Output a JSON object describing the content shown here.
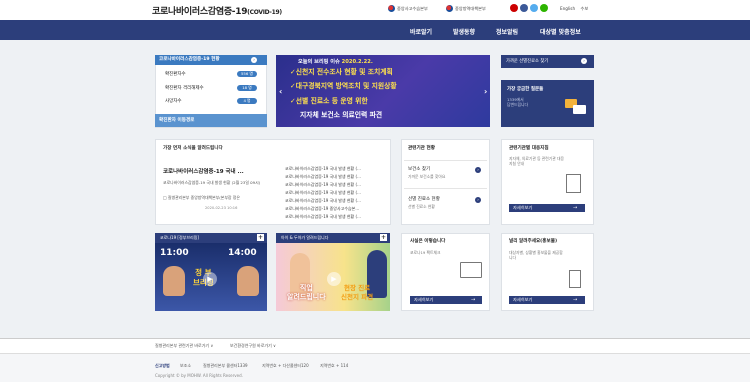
{
  "header": {
    "title_main": "코로나바이러스감염증-19",
    "title_sub": "(COVID-19)",
    "gov1": "중앙사고수습본부",
    "gov2": "중앙방역대책본부",
    "lang": "English",
    "menu": "수보"
  },
  "nav": [
    "바로알기",
    "발생동향",
    "정보알림",
    "대상별 맞춤정보"
  ],
  "status": {
    "title": "코로나바이러스감염증-19 현황",
    "rows": [
      {
        "label": "확진환자수",
        "value": "556 명"
      },
      {
        "label": "확진환자 격리해제수",
        "value": "18 명"
      },
      {
        "label": "사망자수",
        "value": "4 명"
      }
    ],
    "route_link": "확진환자 이동경로"
  },
  "banner": {
    "badge": "오늘의 브리핑 이슈",
    "date": "2020.2.22.",
    "lines": [
      "✓신천지 전수조사 현황 및 조치계획",
      "✓대구경북지역 방역조치 및 지원상황",
      "✓선별 진료소 등 운영 위한",
      "지자체 보건소 의료인력 파견"
    ]
  },
  "right": {
    "clinic_btn": "가까운 선별진료소 찾기",
    "faq_title": "가장 궁금한 질문들",
    "faq_desc": "1339에서\n답변드립니다"
  },
  "news": {
    "title": "가장 먼저 소식을 알려드립니다",
    "featured_title": "코로나바이러스감염증-19 국내 ...",
    "featured_desc": "코로나바이러스감염증-19 국내 발생 현황 (2월 23일 09시)",
    "featured_src": "□ 질병관리본부 중앙방역대책본부(본부장 정은",
    "featured_date": "2020-02-23 10:16",
    "items": [
      "코로나바이러스감염증-19 국내 발생 현황 (...",
      "코로나바이러스감염증-19 국내 발생 현황 (...",
      "코로나바이러스감염증-19 국내 발생 현황 (...",
      "코로나바이러스감염증-19 국내 발생 현황 (...",
      "코로나바이러스감염증-19 국내 발생 현황 (...",
      "코로나바이러스감염증-19 중앙사고수습본...",
      "코로나바이러스감염증-19 국내 발생 현황 (..."
    ]
  },
  "related": {
    "title": "관련기관 현황",
    "items": [
      {
        "t": "보건소 찾기",
        "d": "가까운 보건소를 찾아요"
      },
      {
        "t": "선별 진료소 현황",
        "d": "선별 진료소 현황"
      }
    ]
  },
  "usage": {
    "title": "관련기관별 대응지침",
    "desc": "지자체, 의료기관 등 관련기관 대응\n지침 안내",
    "btn": "자세히보기"
  },
  "video1": {
    "title": "코로나19 [정부브리핑]",
    "time1": "11:00",
    "time2": "14:00",
    "caption": "정 부\n브리핑"
  },
  "video2": {
    "title": "아이 & 두아가 알려드립니다",
    "caption": "직업\n알려드립니다",
    "caption2": "현장 진료\n신천지 파견"
  },
  "fact": {
    "title": "사실은 이렇습니다",
    "desc": "코로나19 팩트체크",
    "btn": "자세히보기"
  },
  "notice": {
    "title": "널리 알려주세요(홍보물)",
    "desc": "대상자별, 상황별 홍보물을 제공합\n니다",
    "btn": "자세히보기"
  },
  "footer": {
    "links": [
      "질병관리본부 관련기관 바로가기 ∨",
      "보건환경연구원 바로가기 ∨"
    ],
    "info": [
      "신고방법",
      "보조소",
      "질병관리본부 콜센터1339",
      "지역번호 + 다산콜센터120",
      "지역번호 + 114"
    ],
    "copyright": "Copyright © by MOHW. All Rights Reserved."
  },
  "colors": {
    "navy": "#2c3e7b",
    "blue": "#3b7ac0",
    "bg": "#eef1f4"
  }
}
